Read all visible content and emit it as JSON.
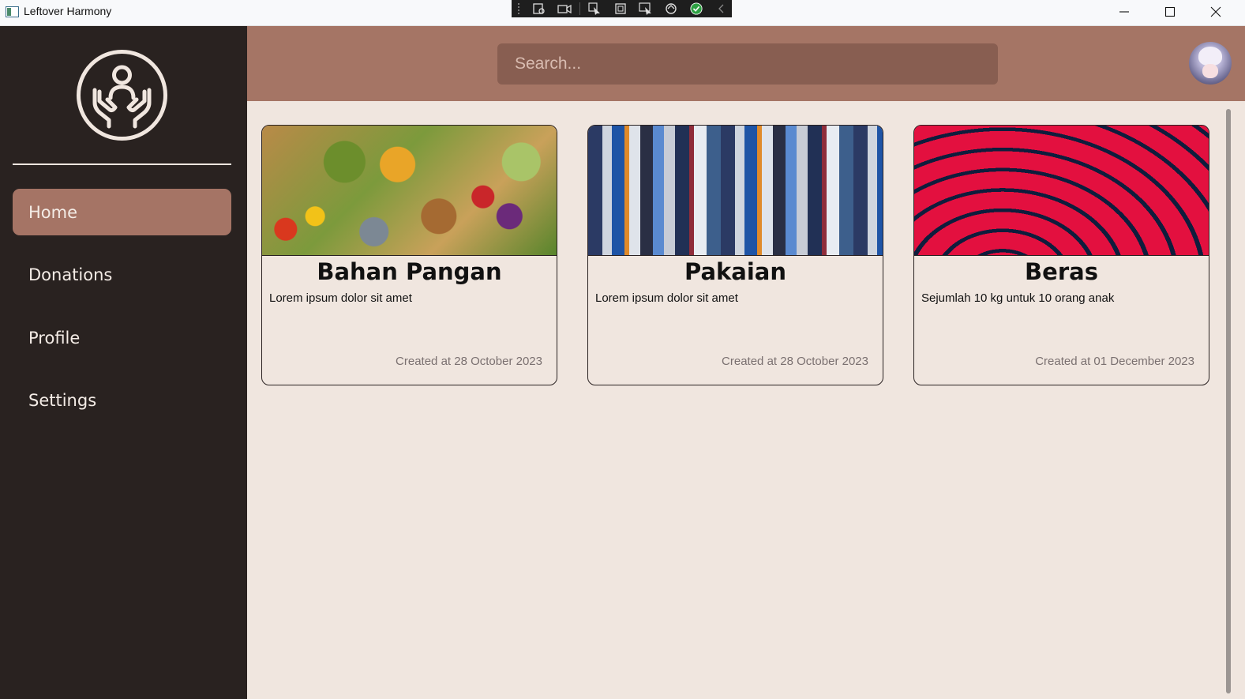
{
  "window": {
    "title": "Leftover Harmony"
  },
  "sidebar": {
    "items": [
      {
        "label": "Home",
        "active": true
      },
      {
        "label": "Donations",
        "active": false
      },
      {
        "label": "Profile",
        "active": false
      },
      {
        "label": "Settings",
        "active": false
      }
    ]
  },
  "header": {
    "search_placeholder": "Search...",
    "avatar": "user-avatar"
  },
  "cards": [
    {
      "title": "Bahan Pangan",
      "description": "Lorem ipsum dolor sit amet",
      "date": "Created at 28 October 2023",
      "image": "vegetables-photo"
    },
    {
      "title": "Pakaian",
      "description": "Lorem ipsum dolor sit amet",
      "date": "Created at 28 October 2023",
      "image": "clothes-rack-photo"
    },
    {
      "title": "Beras",
      "description": "Sejumlah 10 kg untuk 10 orang anak",
      "date": "Created at 01 December 2023",
      "image": "red-wave-pattern"
    }
  ],
  "colors": {
    "sidebar_bg": "#292220",
    "active_item": "#a57465",
    "header_bg": "#a57565",
    "search_bg": "#885e51",
    "content_bg": "#f0e6df"
  },
  "icons": [
    "app-icon",
    "minimize-icon",
    "maximize-icon",
    "close-icon",
    "charity-hands-logo-icon"
  ]
}
